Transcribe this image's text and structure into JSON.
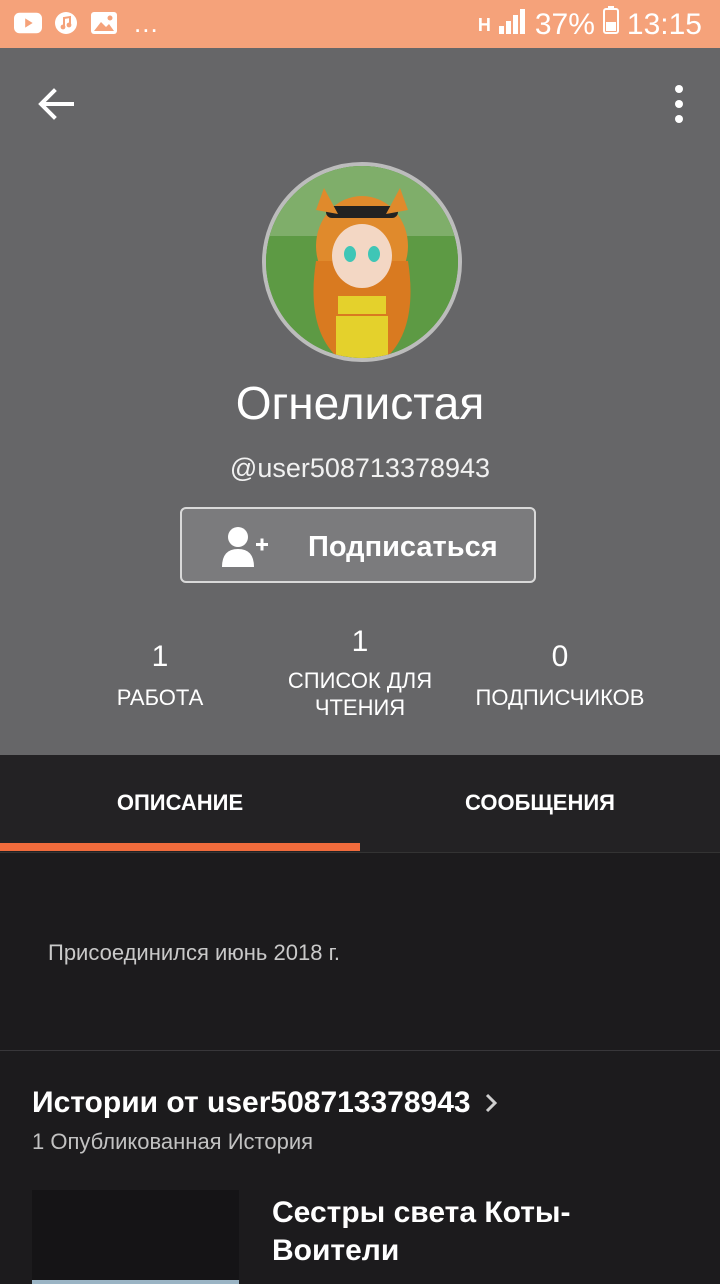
{
  "status_bar": {
    "battery": "37%",
    "time": "13:15",
    "dots": "..."
  },
  "profile": {
    "display_name": "Огнелистая",
    "username": "@user508713378943",
    "follow_label": "Подписаться",
    "stats": [
      {
        "count": "1",
        "label": "РАБОТА"
      },
      {
        "count": "1",
        "label": "СПИСОК ДЛЯ ЧТЕНИЯ"
      },
      {
        "count": "0",
        "label": "ПОДПИСЧИКОВ"
      }
    ]
  },
  "tabs": [
    {
      "label": "ОПИСАНИЕ",
      "active": true
    },
    {
      "label": "СООБЩЕНИЯ",
      "active": false
    }
  ],
  "about": {
    "joined": "Присоединился июнь 2018 г."
  },
  "stories": {
    "title": "Истории от user508713378943",
    "subtitle": "1 Опубликованная История",
    "items": [
      {
        "title": "Сестры света Коты-Воители"
      }
    ]
  },
  "colors": {
    "status_bar": "#f5a27a",
    "header_bg": "#666668",
    "accent": "#f06b3c",
    "page_bg": "#1c1b1d"
  }
}
